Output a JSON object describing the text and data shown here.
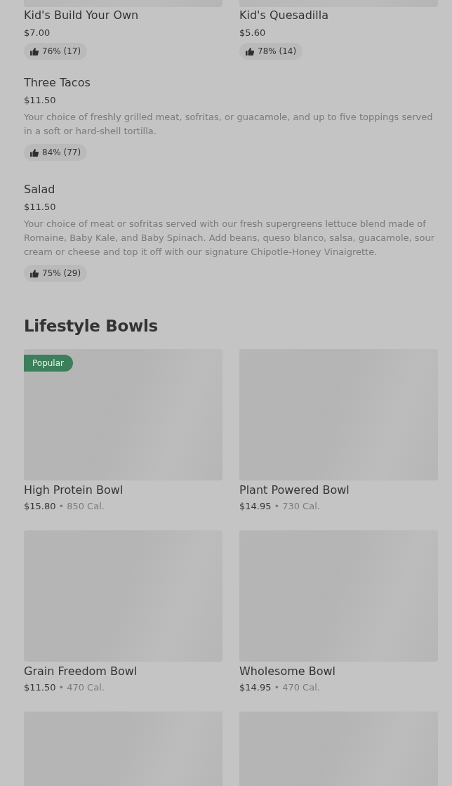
{
  "top_items": [
    {
      "name": "Kid's Build Your Own",
      "price": "$7.00",
      "rating": "76% (17)"
    },
    {
      "name": "Kid's Quesadilla",
      "price": "$5.60",
      "rating": "78% (14)"
    }
  ],
  "items": [
    {
      "name": "Three Tacos",
      "price": "$11.50",
      "description": "Your choice of freshly grilled meat, sofritas, or guacamole, and up to five toppings served in a soft or hard-shell tortilla.",
      "rating": "84% (77)"
    },
    {
      "name": "Salad",
      "price": "$11.50",
      "description": "Your choice of meat or sofritas served with our fresh supergreens lettuce blend made of Romaine, Baby Kale, and Baby Spinach. Add beans, queso blanco, salsa, guacamole, sour cream or cheese and top it off with our signature Chipotle-Honey Vinaigrette.",
      "rating": "75% (29)"
    }
  ],
  "section": {
    "title": "Lifestyle Bowls",
    "items": [
      {
        "kind": "full",
        "name": "High Protein Bowl",
        "price": "$15.80",
        "separator": "•",
        "calories": "850 Cal.",
        "badge": "Popular"
      },
      {
        "kind": "full",
        "name": "Plant Powered Bowl",
        "price": "$14.95",
        "separator": "•",
        "calories": "730 Cal."
      },
      {
        "kind": "full",
        "name": "Grain Freedom Bowl",
        "price": "$11.50",
        "separator": "•",
        "calories": "470 Cal."
      },
      {
        "kind": "full",
        "name": "Wholesome Bowl",
        "price": "$14.95",
        "separator": "•",
        "calories": "470 Cal."
      },
      {
        "kind": "image_only"
      },
      {
        "kind": "image_only"
      }
    ]
  }
}
